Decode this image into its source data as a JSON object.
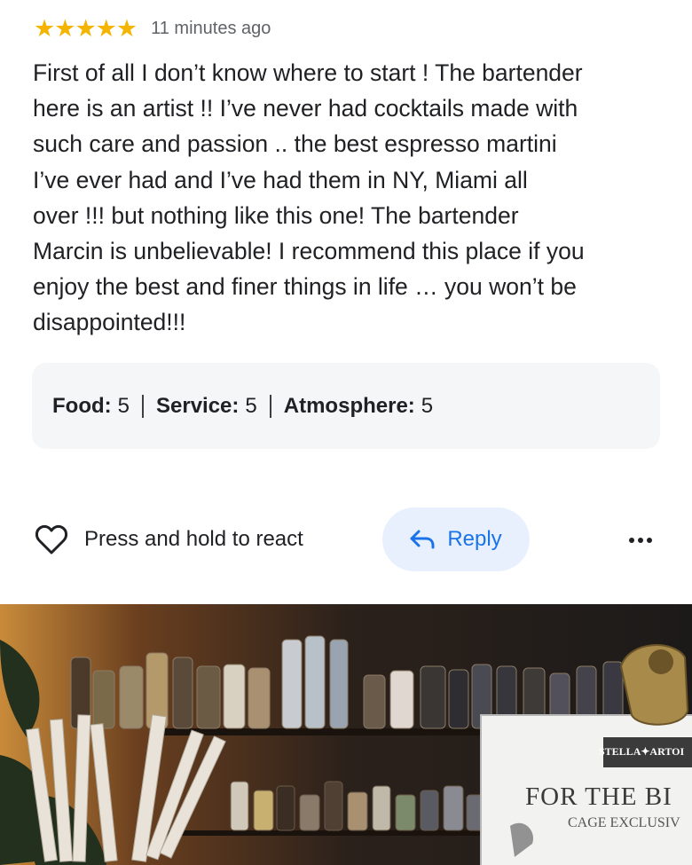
{
  "review": {
    "rating_stars": 5,
    "time_ago": "11 minutes ago",
    "text": "First of all I don’t know where to start ! The bartender\nhere is an artist !! I’ve never had cocktails made with\nsuch care and passion .. the best espresso martini\nI’ve ever had and I’ve had them in NY, Miami all\nover !!! but nothing like this one! The bartender\nMarcin is unbelievable! I recommend this place if you\nenjoy the best and finer things in life … you won’t be\ndisappointed!!!"
  },
  "ratings": [
    {
      "label": "Food",
      "value": "5"
    },
    {
      "label": "Service",
      "value": "5"
    },
    {
      "label": "Atmosphere",
      "value": "5"
    }
  ],
  "actions": {
    "react_label": "Press and hold to react",
    "reply_label": "Reply"
  },
  "photo": {
    "sign_brand": "STELLA✦ARTOI",
    "sign_title": "FOR THE BI",
    "sign_subtitle": "CAGE EXCLUSIV"
  },
  "colors": {
    "star": "#f5b400",
    "reply_bg": "#e8f0fe",
    "reply_text": "#1a73e8",
    "ratings_bg": "#f5f6f7"
  }
}
